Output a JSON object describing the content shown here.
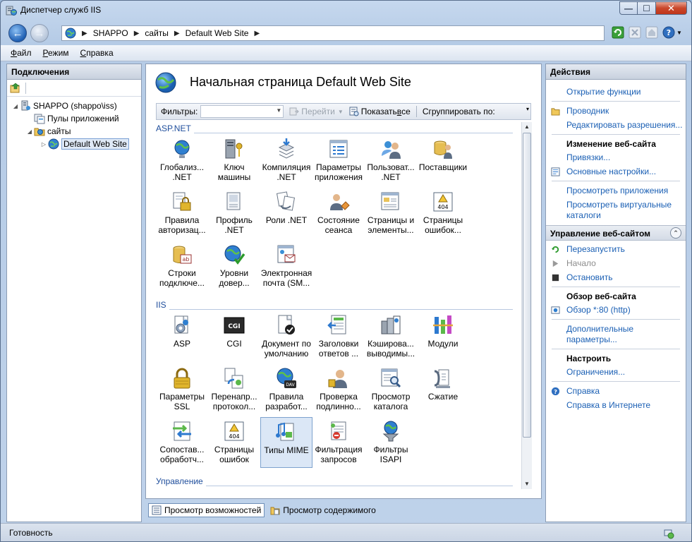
{
  "window": {
    "title": "Диспетчер служб IIS",
    "controls": {
      "minimize": "—",
      "maximize": "☐",
      "close": "✕"
    }
  },
  "address": {
    "segments": [
      "SHAPPO",
      "сайты",
      "Default Web Site"
    ]
  },
  "menu": [
    {
      "accel": "Ф",
      "rest": "айл"
    },
    {
      "accel": "Р",
      "rest": "ежим"
    },
    {
      "accel": "С",
      "rest": "правка"
    }
  ],
  "connections": {
    "title": "Подключения",
    "tree": [
      {
        "label": "SHAPPO (shappo\\iss)",
        "icon": "server-icon"
      },
      {
        "label": "Пулы приложений",
        "icon": "app-pools-icon"
      },
      {
        "label": "сайты",
        "icon": "sites-folder-icon"
      },
      {
        "label": "Default Web Site",
        "icon": "globe-icon"
      }
    ]
  },
  "center": {
    "title": "Начальная страница Default Web Site",
    "filter": {
      "label": "Фильтры:",
      "go": "Перейти",
      "show_all_prefix": "Показать ",
      "show_all_accel": "в",
      "show_all_suffix": "се",
      "group_by": "Сгруппировать по:"
    },
    "groups": [
      {
        "name": "ASP.NET",
        "items": [
          {
            "label": "Глобализ... .NET",
            "icon": "globe-icon"
          },
          {
            "label": "Ключ машины",
            "icon": "machine-key-icon"
          },
          {
            "label": "Компиляция .NET",
            "icon": "compilation-icon"
          },
          {
            "label": "Параметры приложения",
            "icon": "app-settings-icon"
          },
          {
            "label": "Пользоват... .NET",
            "icon": "users-icon"
          },
          {
            "label": "Поставщики",
            "icon": "providers-icon"
          },
          {
            "label": "Правила авторизац...",
            "icon": "lock-icon"
          },
          {
            "label": "Профиль .NET",
            "icon": "profile-icon"
          },
          {
            "label": "Роли .NET",
            "icon": "roles-icon"
          },
          {
            "label": "Состояние сеанса",
            "icon": "session-state-icon"
          },
          {
            "label": "Страницы и элементы...",
            "icon": "pages-controls-icon"
          },
          {
            "label": "Страницы ошибок...",
            "icon": "error-pages-icon"
          },
          {
            "label": "Строки подключе...",
            "icon": "connection-strings-icon"
          },
          {
            "label": "Уровни довер...",
            "icon": "trust-levels-icon"
          },
          {
            "label": "Электронная почта (SM...",
            "icon": "email-icon"
          }
        ]
      },
      {
        "name": "IIS",
        "items": [
          {
            "label": "ASP",
            "icon": "asp-icon"
          },
          {
            "label": "CGI",
            "icon": "cgi-icon"
          },
          {
            "label": "Документ по умолчанию",
            "icon": "default-document-icon"
          },
          {
            "label": "Заголовки ответов ...",
            "icon": "response-headers-icon"
          },
          {
            "label": "Кэширова... выводимы...",
            "icon": "output-caching-icon"
          },
          {
            "label": "Модули",
            "icon": "modules-icon"
          },
          {
            "label": "Параметры SSL",
            "icon": "ssl-lock-icon"
          },
          {
            "label": "Перенапр... протокол...",
            "icon": "redirect-icon"
          },
          {
            "label": "Правила разработ...",
            "icon": "webdav-icon"
          },
          {
            "label": "Проверка подлинно...",
            "icon": "authentication-icon"
          },
          {
            "label": "Просмотр каталога",
            "icon": "directory-browsing-icon"
          },
          {
            "label": "Сжатие",
            "icon": "compression-icon"
          },
          {
            "label": "Сопостав... обработч...",
            "icon": "handler-mappings-icon"
          },
          {
            "label": "Страницы ошибок",
            "icon": "error-pages-icon"
          },
          {
            "label": "Типы MIME",
            "icon": "mime-types-icon",
            "selected": true
          },
          {
            "label": "Фильтрация запросов",
            "icon": "request-filtering-icon"
          },
          {
            "label": "Фильтры ISAPI",
            "icon": "isapi-filters-icon"
          }
        ]
      },
      {
        "name": "Управление",
        "items": []
      }
    ],
    "view_tabs": [
      {
        "label": "Просмотр возможностей",
        "active": true
      },
      {
        "label": "Просмотр содержимого",
        "active": false
      }
    ]
  },
  "actions": {
    "title": "Действия",
    "open_feature": "Открытие функции",
    "explore": "Проводник",
    "edit_permissions": "Редактировать разрешения...",
    "edit_site_head": "Изменение веб-сайта",
    "bindings": "Привязки...",
    "basic_settings": "Основные настройки...",
    "view_apps": "Просмотреть приложения",
    "view_vdirs": "Просмотреть виртуальные каталоги",
    "manage_head": "Управление веб-сайтом",
    "restart": "Перезапустить",
    "start": "Начало",
    "stop": "Остановить",
    "browse_head": "Обзор веб-сайта",
    "browse_80": "Обзор *:80 (http)",
    "advanced": "Дополнительные параметры...",
    "configure_head": "Настроить",
    "limits": "Ограничения...",
    "help": "Справка",
    "online_help": "Справка в Интернете"
  },
  "status": {
    "text": "Готовность"
  }
}
